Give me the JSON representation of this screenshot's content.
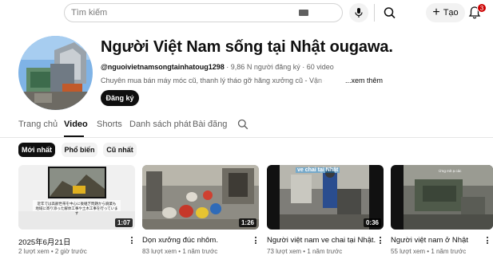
{
  "topbar": {
    "search_placeholder": "Tìm kiếm",
    "create_label": "Tạo",
    "notification_count": "3"
  },
  "channel": {
    "name": "Người Việt Nam sống tại Nhật ougawa.",
    "handle": "@nguoivietnamsongtainhatoug1298",
    "subscribers": "9,86 N người đăng ký",
    "videos": "60 video",
    "separator": " · ",
    "description": "Chuyên mua bán máy móc cũ, thanh lý tháo gỡ hãng xưởng cũ - Vận chuyển t...",
    "more_label": "...xem thêm",
    "subscribe_label": "Đăng ký"
  },
  "tabs": [
    "Trang chủ",
    "Video",
    "Shorts",
    "Danh sách phát",
    "Bài đăng"
  ],
  "active_tab": "Video",
  "chips": [
    "Mới nhất",
    "Phổ biến",
    "Cũ nhất"
  ],
  "active_chip": "Mới nhất",
  "videos": [
    {
      "title": "2025年6月21日",
      "views": "2 lượt xem",
      "age": "2 giờ trước",
      "duration": "1:07",
      "overlay_text": [
        "近年では高齢世帯を中心に後継ぎ問題から廃業も",
        "地域に寄り添った解体工事や土木工事を行っています"
      ]
    },
    {
      "title": "Dọn xưởng đúc nhôm.",
      "views": "83 lượt xem",
      "age": "1 năm trước",
      "duration": "1:26"
    },
    {
      "title": "Người việt nam ve chai tại Nhật.",
      "views": "73 lượt xem",
      "age": "1 năm trước",
      "duration": "0:36",
      "overlay_text": [
        "ve chai tại Nhật"
      ]
    },
    {
      "title": "Người việt nam ở Nhật",
      "views": "55 lượt xem",
      "age": "1 năm trước",
      "duration": "",
      "overlay_text": [
        "Ứng mít ạ các"
      ]
    }
  ],
  "colors": {
    "accent": "#0f0f0f",
    "badge": "#cc0000",
    "secondary_text": "#606060",
    "chip_bg": "#f2f2f2"
  },
  "icons": [
    "search-icon",
    "keyboard-icon",
    "mic-icon",
    "plus-icon",
    "bell-icon",
    "kebab-icon"
  ]
}
